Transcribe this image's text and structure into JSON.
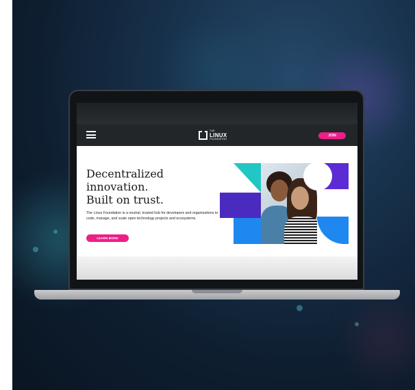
{
  "site": {
    "logo": {
      "the": "THE",
      "name": "LINUX",
      "sub": "FOUNDATION"
    },
    "nav": {
      "join_label": "JOIN"
    },
    "hero": {
      "title_lines": [
        "Decentralized",
        "innovation.",
        "Built on trust."
      ],
      "description": "The Linux Foundation is a neutral, trusted hub for developers and organizations to code, manage, and scale open technology projects and ecosystems.",
      "cta_label": "LEARN MORE"
    }
  },
  "colors": {
    "accent": "#ec1f8b",
    "nav_bg": "#232629",
    "shape_purple": "#5b2bd6",
    "shape_blue": "#1e88f0",
    "shape_teal": "#22c7c3"
  },
  "icons": [
    "hamburger-menu-icon",
    "linux-foundation-logo"
  ]
}
